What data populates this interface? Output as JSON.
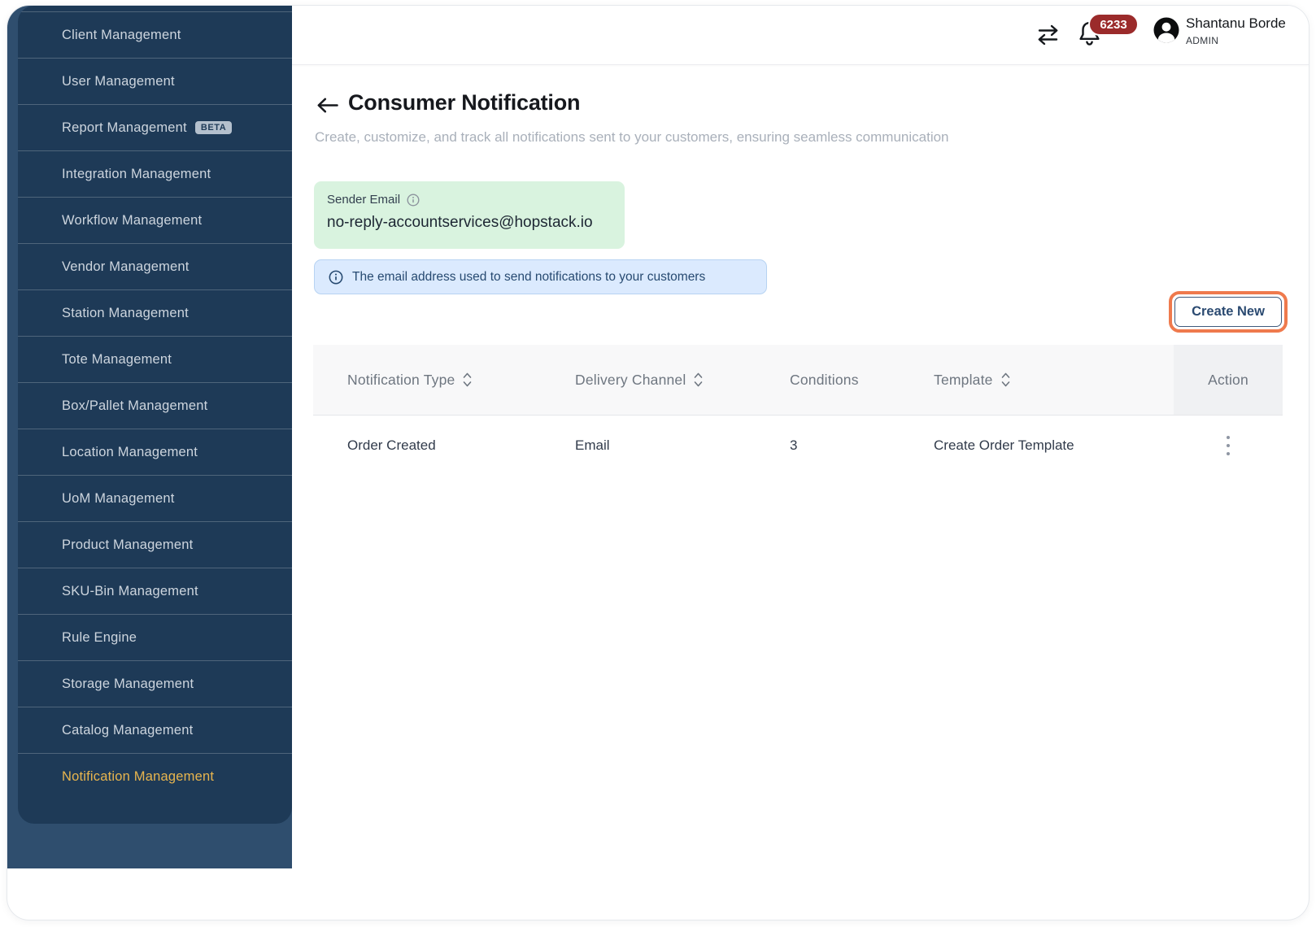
{
  "topbar": {
    "notification_badge_count": "6233",
    "user": {
      "name": "Shantanu Borde",
      "role": "ADMIN"
    },
    "icons": [
      "switch-workspace-icon",
      "bell-icon",
      "avatar-icon"
    ]
  },
  "sidebar": {
    "items": [
      {
        "label": "Client Management"
      },
      {
        "label": "User Management"
      },
      {
        "label": "Report Management",
        "badge": "BETA"
      },
      {
        "label": "Integration Management"
      },
      {
        "label": "Workflow Management"
      },
      {
        "label": "Vendor Management"
      },
      {
        "label": "Station Management"
      },
      {
        "label": "Tote Management"
      },
      {
        "label": "Box/Pallet Management"
      },
      {
        "label": "Location Management"
      },
      {
        "label": "UoM Management"
      },
      {
        "label": "Product Management"
      },
      {
        "label": "SKU-Bin Management"
      },
      {
        "label": "Rule Engine"
      },
      {
        "label": "Storage Management"
      },
      {
        "label": "Catalog Management"
      },
      {
        "label": "Notification Management",
        "active": true
      }
    ]
  },
  "page": {
    "title": "Consumer Notification",
    "subtitle": "Create, customize, and track all notifications sent to your customers, ensuring seamless communication"
  },
  "sender_email": {
    "label": "Sender Email",
    "value": "no-reply-accountservices@hopstack.io",
    "icon": "info-icon"
  },
  "info_banner": {
    "icon": "info-icon",
    "text": "The email address used to send notifications to your customers"
  },
  "actions": {
    "create_new": "Create New"
  },
  "table": {
    "columns": [
      {
        "label": "Notification Type",
        "sortable": true
      },
      {
        "label": "Delivery Channel",
        "sortable": true
      },
      {
        "label": "Conditions",
        "sortable": false
      },
      {
        "label": "Template",
        "sortable": true
      },
      {
        "label": "Action",
        "sortable": false
      }
    ],
    "rows": [
      {
        "notification_type": "Order Created",
        "delivery_channel": "Email",
        "conditions": "3",
        "template": "Create Order Template"
      }
    ]
  },
  "colors": {
    "sidebar_bg": "#2f4e6e",
    "sidebar_panel_bg": "#1e3a57",
    "active_item": "#e8b54e",
    "notification_badge_bg": "#9b2b2b",
    "highlight_ring": "#ef7a4d",
    "sender_email_bg": "#d9f3df",
    "info_banner_bg": "#dbeafe",
    "button_text": "#2b4a71"
  }
}
